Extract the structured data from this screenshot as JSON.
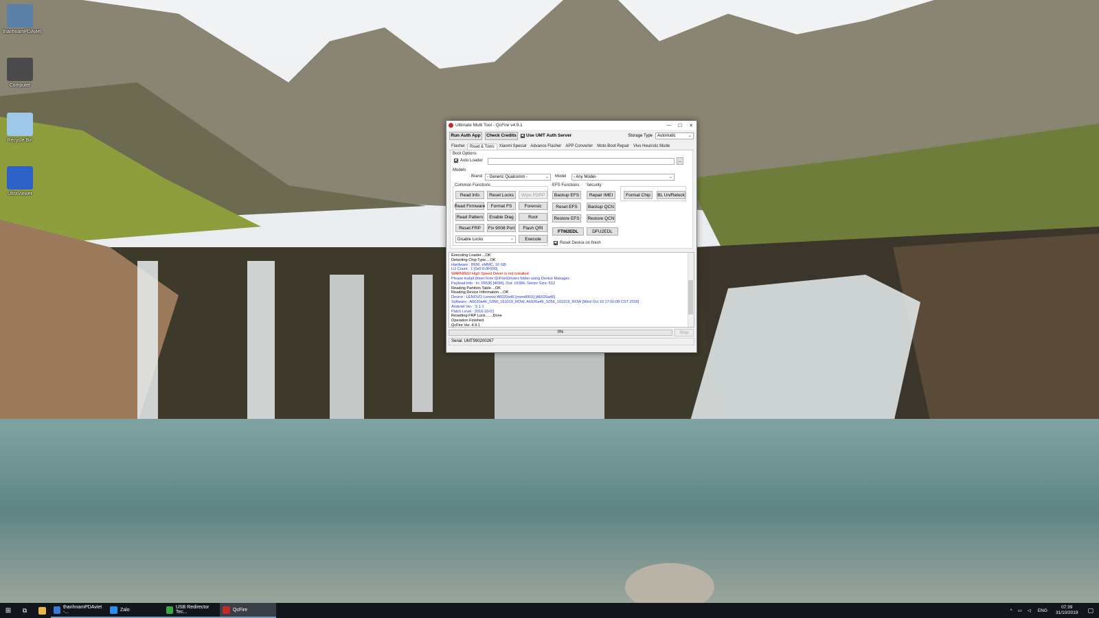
{
  "desktop": {
    "icons": [
      {
        "label": "thanhnamPDAviet",
        "color": "#5b7fa6"
      },
      {
        "label": "Computer",
        "color": "#4a4a4a"
      },
      {
        "label": "Recycle Bin",
        "color": "#9fc7e8"
      },
      {
        "label": "UltraViewer",
        "color": "#2f62c7"
      }
    ]
  },
  "window": {
    "title": "Ultimate Multi Tool - QcFire v4.9.1",
    "controls": {
      "minimize": "—",
      "maximize": "☐",
      "close": "✕"
    },
    "toolbar": {
      "run_auth": "Run Auth App",
      "check_credits": "Check Credits",
      "use_umt_auth": "Use UMT Auth Server",
      "storage_type_label": "Storage Type",
      "storage_type_value": "Automatic"
    },
    "tabs": [
      "Flasher",
      "Read & Tools",
      "Xiaomi Special",
      "Advance Flasher",
      "APP Converter",
      "Moto Boot Repair",
      "Vivo Heuristic Mode"
    ],
    "boot_options": {
      "label": "Boot Options",
      "auto_loader": "Auto Loader",
      "browse": "..."
    },
    "models": {
      "label": "Models",
      "brand_label": "Brand",
      "brand_value": "- Generic Qualcomm -",
      "model_label": "Model",
      "model_value": "- Any Model-"
    },
    "common_functions": {
      "label": "Common Functions",
      "buttons": [
        "Read Info",
        "Reset Locks",
        "Wipe FDRP",
        "Read Firmware",
        "Format FS",
        "Forensic",
        "Read Pattern",
        "Enable Diag",
        "Root",
        "Reset FRP",
        "Fix 9008 Port",
        "Flash QRI"
      ],
      "dropdown_value": "Disable Locks",
      "execute": "Execute"
    },
    "efs_functions": {
      "label": "EFS Functions",
      "buttons": [
        "Backup EFS",
        "Reset EFS",
        "Restore EFS"
      ],
      "ftm2edl": "FTM2EDL"
    },
    "security": {
      "label": "Security",
      "buttons": [
        "Repair IMEI",
        "Backup QCN",
        "Restore QCN"
      ],
      "dfu2edl": "DFU2EDL"
    },
    "extra": {
      "format_chip": "Format Chip",
      "bl_unrelock": "BL Un/Relock",
      "reset_device": "Reset Device on finish"
    },
    "log": [
      {
        "text": "Executing Loader....OK",
        "color": "#000000"
      },
      {
        "text": "Detecting Chip Type....OK",
        "color": "#000000"
      },
      {
        "text": "Hardware       : 8936, eMMC, 16 GB",
        "color": "#1f3bd6"
      },
      {
        "text": "LU Count       : 1 [0x0:0:0F000]",
        "color": "#1f3bd6"
      },
      {
        "text": "WARNING! High Speed Driver is not installed.",
        "color": "#d60000"
      },
      {
        "text": "Please install driver from QcFire\\Drivers folder using Device Manager.",
        "color": "#1f3bd6"
      },
      {
        "text": "Payload Info   : In: 65536 [4096], Out: 16384, Sector Size: 512",
        "color": "#1f3bd6"
      },
      {
        "text": "Reading Partition Table....OK",
        "color": "#000000"
      },
      {
        "text": "Reading Device Information....OK",
        "color": "#000000"
      },
      {
        "text": "Device         : LENOVO Lenovo A6020a46 [msm8916] [A6020a46]",
        "color": "#1f3bd6"
      },
      {
        "text": "Software       : A6020a46_S056_161019_ROW, A6020a46_S056_161019_ROW [Wed Oct 19 17:50:08 CST 2016]",
        "color": "#1f3bd6"
      },
      {
        "text": "Android Ver.   : 5.1.1",
        "color": "#1f3bd6"
      },
      {
        "text": "Patch Level    : 2016-10-01",
        "color": "#1f3bd6"
      },
      {
        "text": "Resetting FRP Lock.......Done",
        "color": "#000000"
      },
      {
        "text": "Operation Finished.",
        "color": "#000000"
      },
      {
        "text": "QcFire Ver. 4.9.1",
        "color": "#000000"
      }
    ],
    "progress": {
      "value": 0,
      "text": "0%"
    },
    "stop": "Stop",
    "status": "Serial: UMT990200267"
  },
  "taskbar": {
    "tasks": [
      {
        "label": "thanhnamPDAviet -...",
        "color": "#3b78d8"
      },
      {
        "label": "Zalo",
        "color": "#2f8bf0"
      },
      {
        "label": "USB Redirector Tec...",
        "color": "#3aa64a"
      },
      {
        "label": "QcFire",
        "color": "#c62828"
      }
    ],
    "tray": {
      "lang": "ENG",
      "time": "07:39",
      "date": "31/10/2019"
    }
  }
}
